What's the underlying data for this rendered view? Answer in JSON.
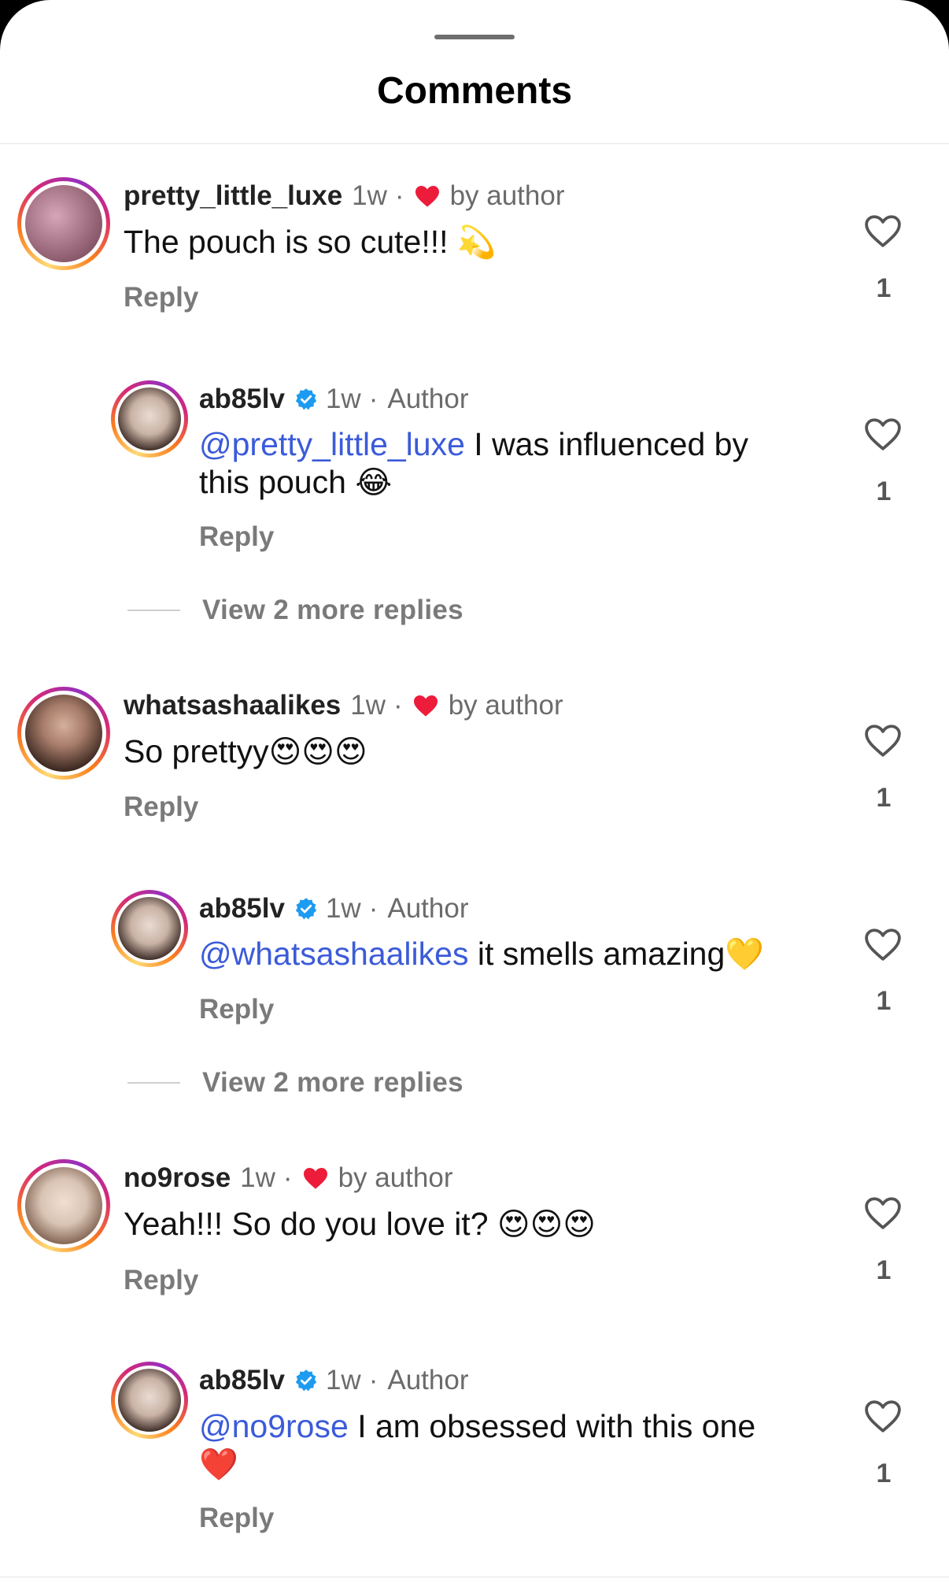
{
  "sheet": {
    "title": "Comments"
  },
  "comments": [
    {
      "username": "pretty_little_luxe",
      "time": "1w",
      "author_like": "by author",
      "text": "The pouch is so cute!!!",
      "emoji": "💫",
      "reply_label": "Reply",
      "likes": "1",
      "avatar_colors": [
        "#d7a6b8",
        "#6a3b4c"
      ]
    },
    {
      "username": "ab85lv",
      "time": "1w",
      "badge": "Author",
      "mention": "@pretty_little_luxe",
      "text_line1": " I was influenced by",
      "text_line2": "this pouch",
      "emoji": "😂",
      "reply_label": "Reply",
      "likes": "1",
      "avatar_colors": [
        "#e9dcd4",
        "#3a2a24"
      ]
    },
    {
      "view_more": "View 2 more replies"
    },
    {
      "username": "whatsashaalikes",
      "time": "1w",
      "author_like": "by author",
      "text": "So prettyy",
      "emoji": "😍😍😍",
      "reply_label": "Reply",
      "likes": "1",
      "avatar_colors": [
        "#a77c6a",
        "#3c2820"
      ]
    },
    {
      "username": "ab85lv",
      "time": "1w",
      "badge": "Author",
      "mention": "@whatsashaalikes",
      "text": " it smells amazing",
      "emoji": "💛",
      "reply_label": "Reply",
      "likes": "1",
      "avatar_colors": [
        "#e9dcd4",
        "#3a2a24"
      ]
    },
    {
      "view_more": "View 2 more replies"
    },
    {
      "username": "no9rose",
      "time": "1w",
      "author_like": "by author",
      "text": "Yeah!!! So do you love it?",
      "emoji": "😍😍😍",
      "reply_label": "Reply",
      "likes": "1",
      "avatar_colors": [
        "#d9c4b4",
        "#7a5b49"
      ]
    },
    {
      "username": "ab85lv",
      "time": "1w",
      "badge": "Author",
      "mention": "@no9rose",
      "text_line1": " I am obsessed with this one",
      "emoji": "❤️",
      "reply_label": "Reply",
      "likes": "1",
      "avatar_colors": [
        "#e9dcd4",
        "#3a2a24"
      ]
    }
  ],
  "colors": {
    "mention": "#3b5bd9",
    "heart_red": "#ed1c3a",
    "verified_blue": "#1d9bf0",
    "muted_text": "#6b6b6b"
  },
  "icons": {
    "like": "heart-outline-icon",
    "author_like": "heart-filled-icon",
    "verified": "verified-badge-icon"
  }
}
